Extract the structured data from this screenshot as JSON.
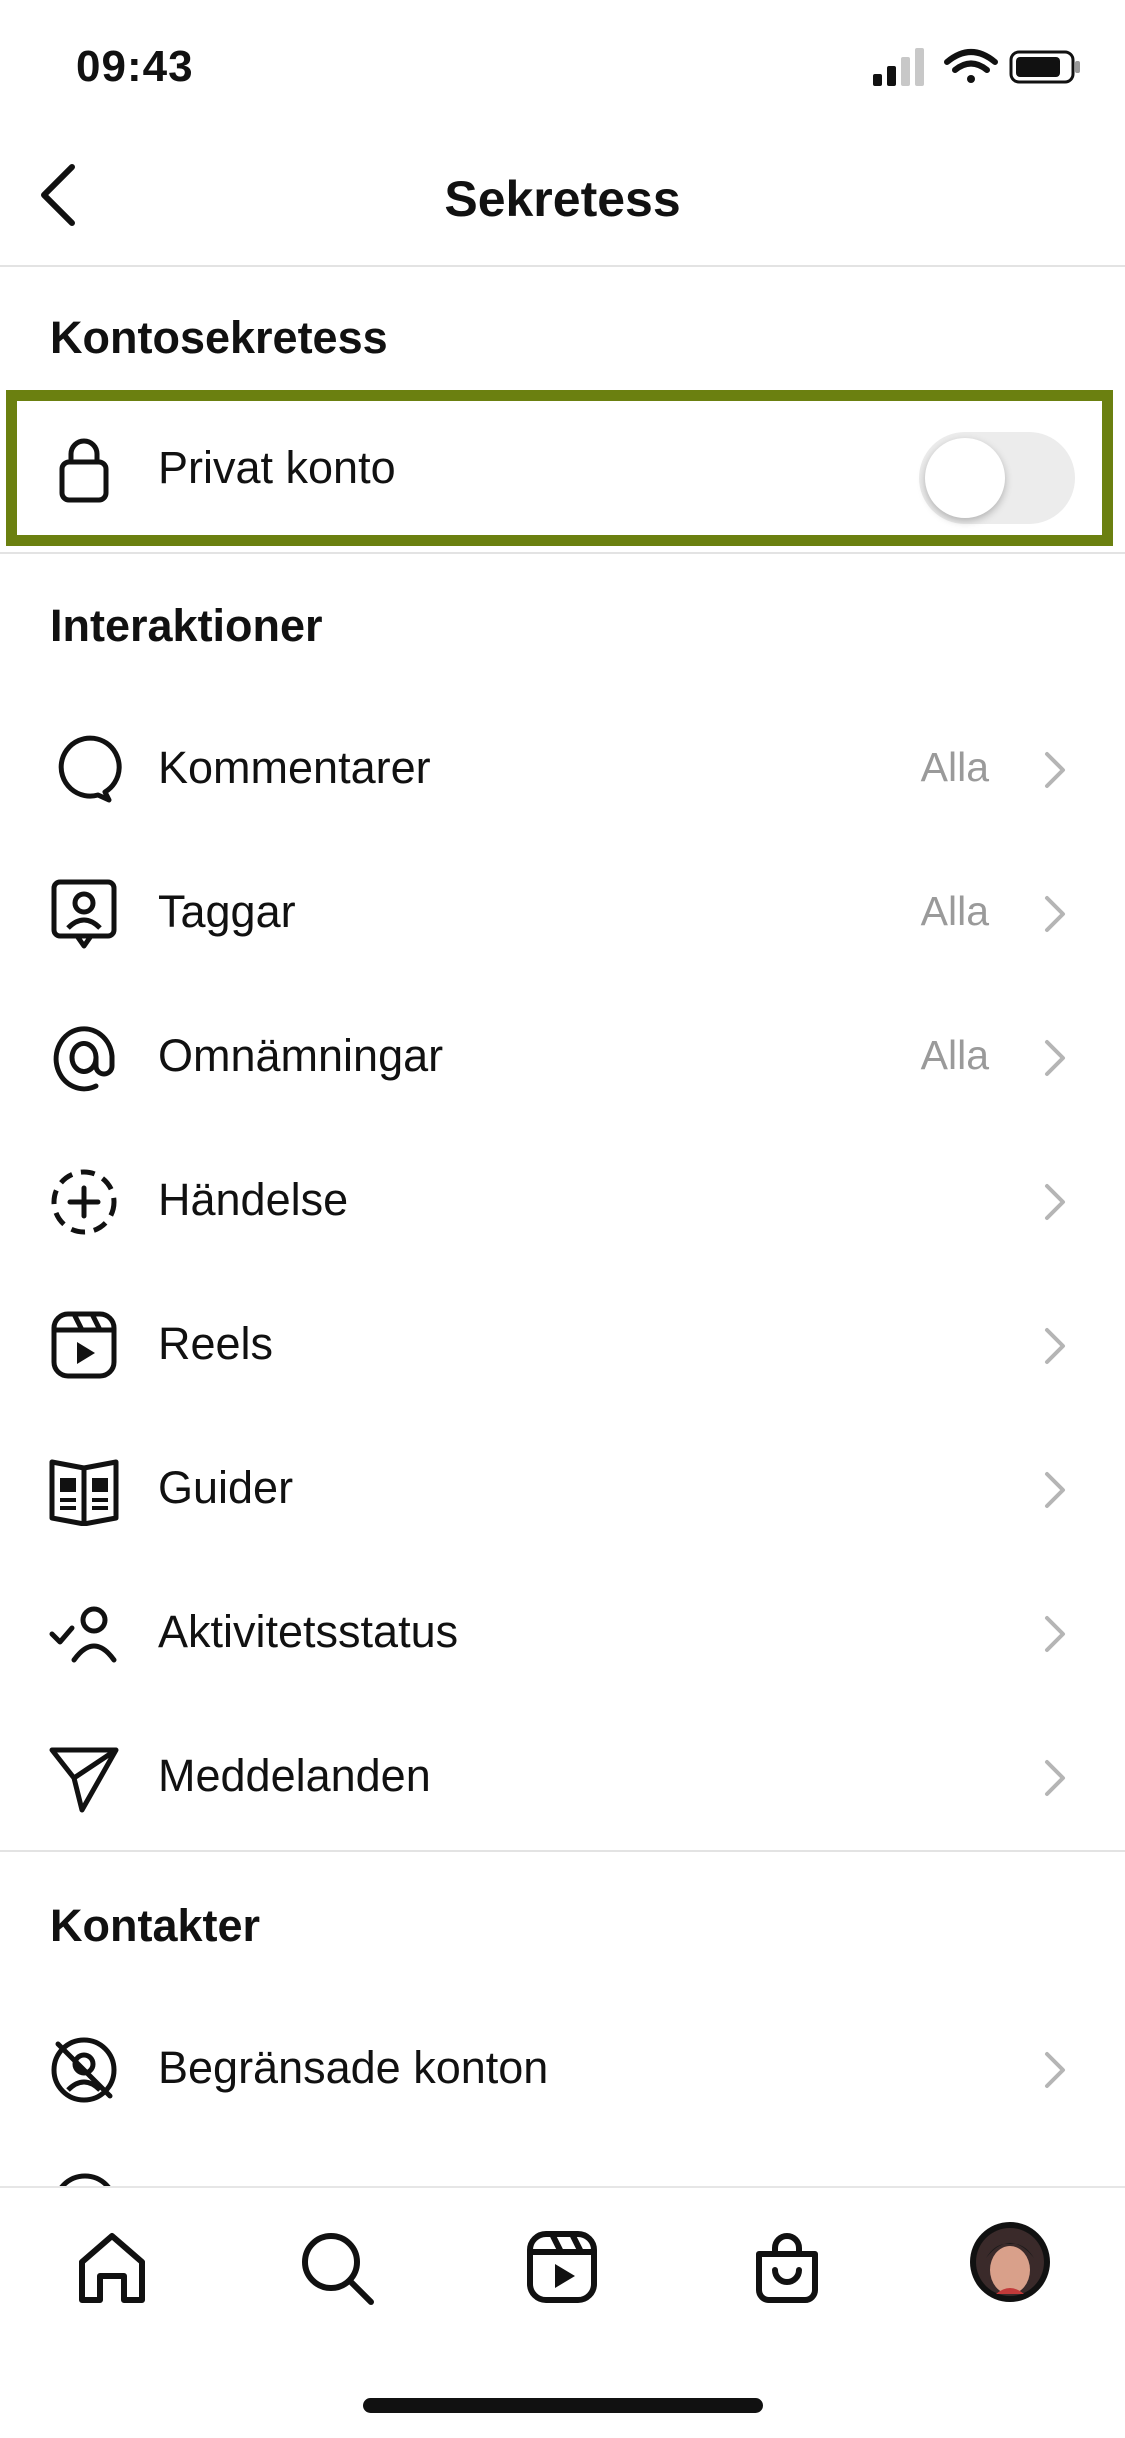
{
  "status_bar": {
    "time": "09:43"
  },
  "header": {
    "title": "Sekretess"
  },
  "sections": {
    "account_privacy": {
      "title": "Kontosekretess",
      "private_account": {
        "label": "Privat konto",
        "icon": "lock-icon",
        "enabled": false
      }
    },
    "interactions": {
      "title": "Interaktioner",
      "items": [
        {
          "label": "Kommentarer",
          "value": "Alla",
          "icon": "comment-icon"
        },
        {
          "label": "Taggar",
          "value": "Alla",
          "icon": "tag-person-icon"
        },
        {
          "label": "Omnämningar",
          "value": "Alla",
          "icon": "at-icon"
        },
        {
          "label": "Händelse",
          "value": "",
          "icon": "story-add-icon"
        },
        {
          "label": "Reels",
          "value": "",
          "icon": "reels-icon"
        },
        {
          "label": "Guider",
          "value": "",
          "icon": "guide-icon"
        },
        {
          "label": "Aktivitetsstatus",
          "value": "",
          "icon": "activity-status-icon"
        },
        {
          "label": "Meddelanden",
          "value": "",
          "icon": "send-icon"
        }
      ]
    },
    "contacts": {
      "title": "Kontakter",
      "items": [
        {
          "label": "Begränsade konton",
          "value": "",
          "icon": "restricted-icon"
        }
      ]
    }
  },
  "tab_bar": {
    "tabs": [
      "home-icon",
      "search-icon",
      "reels-icon",
      "shop-icon",
      "profile-avatar"
    ]
  },
  "colors": {
    "highlight": "#6b8010",
    "secondary_text": "#9a9a9a",
    "toggle_off": "#ececec"
  }
}
